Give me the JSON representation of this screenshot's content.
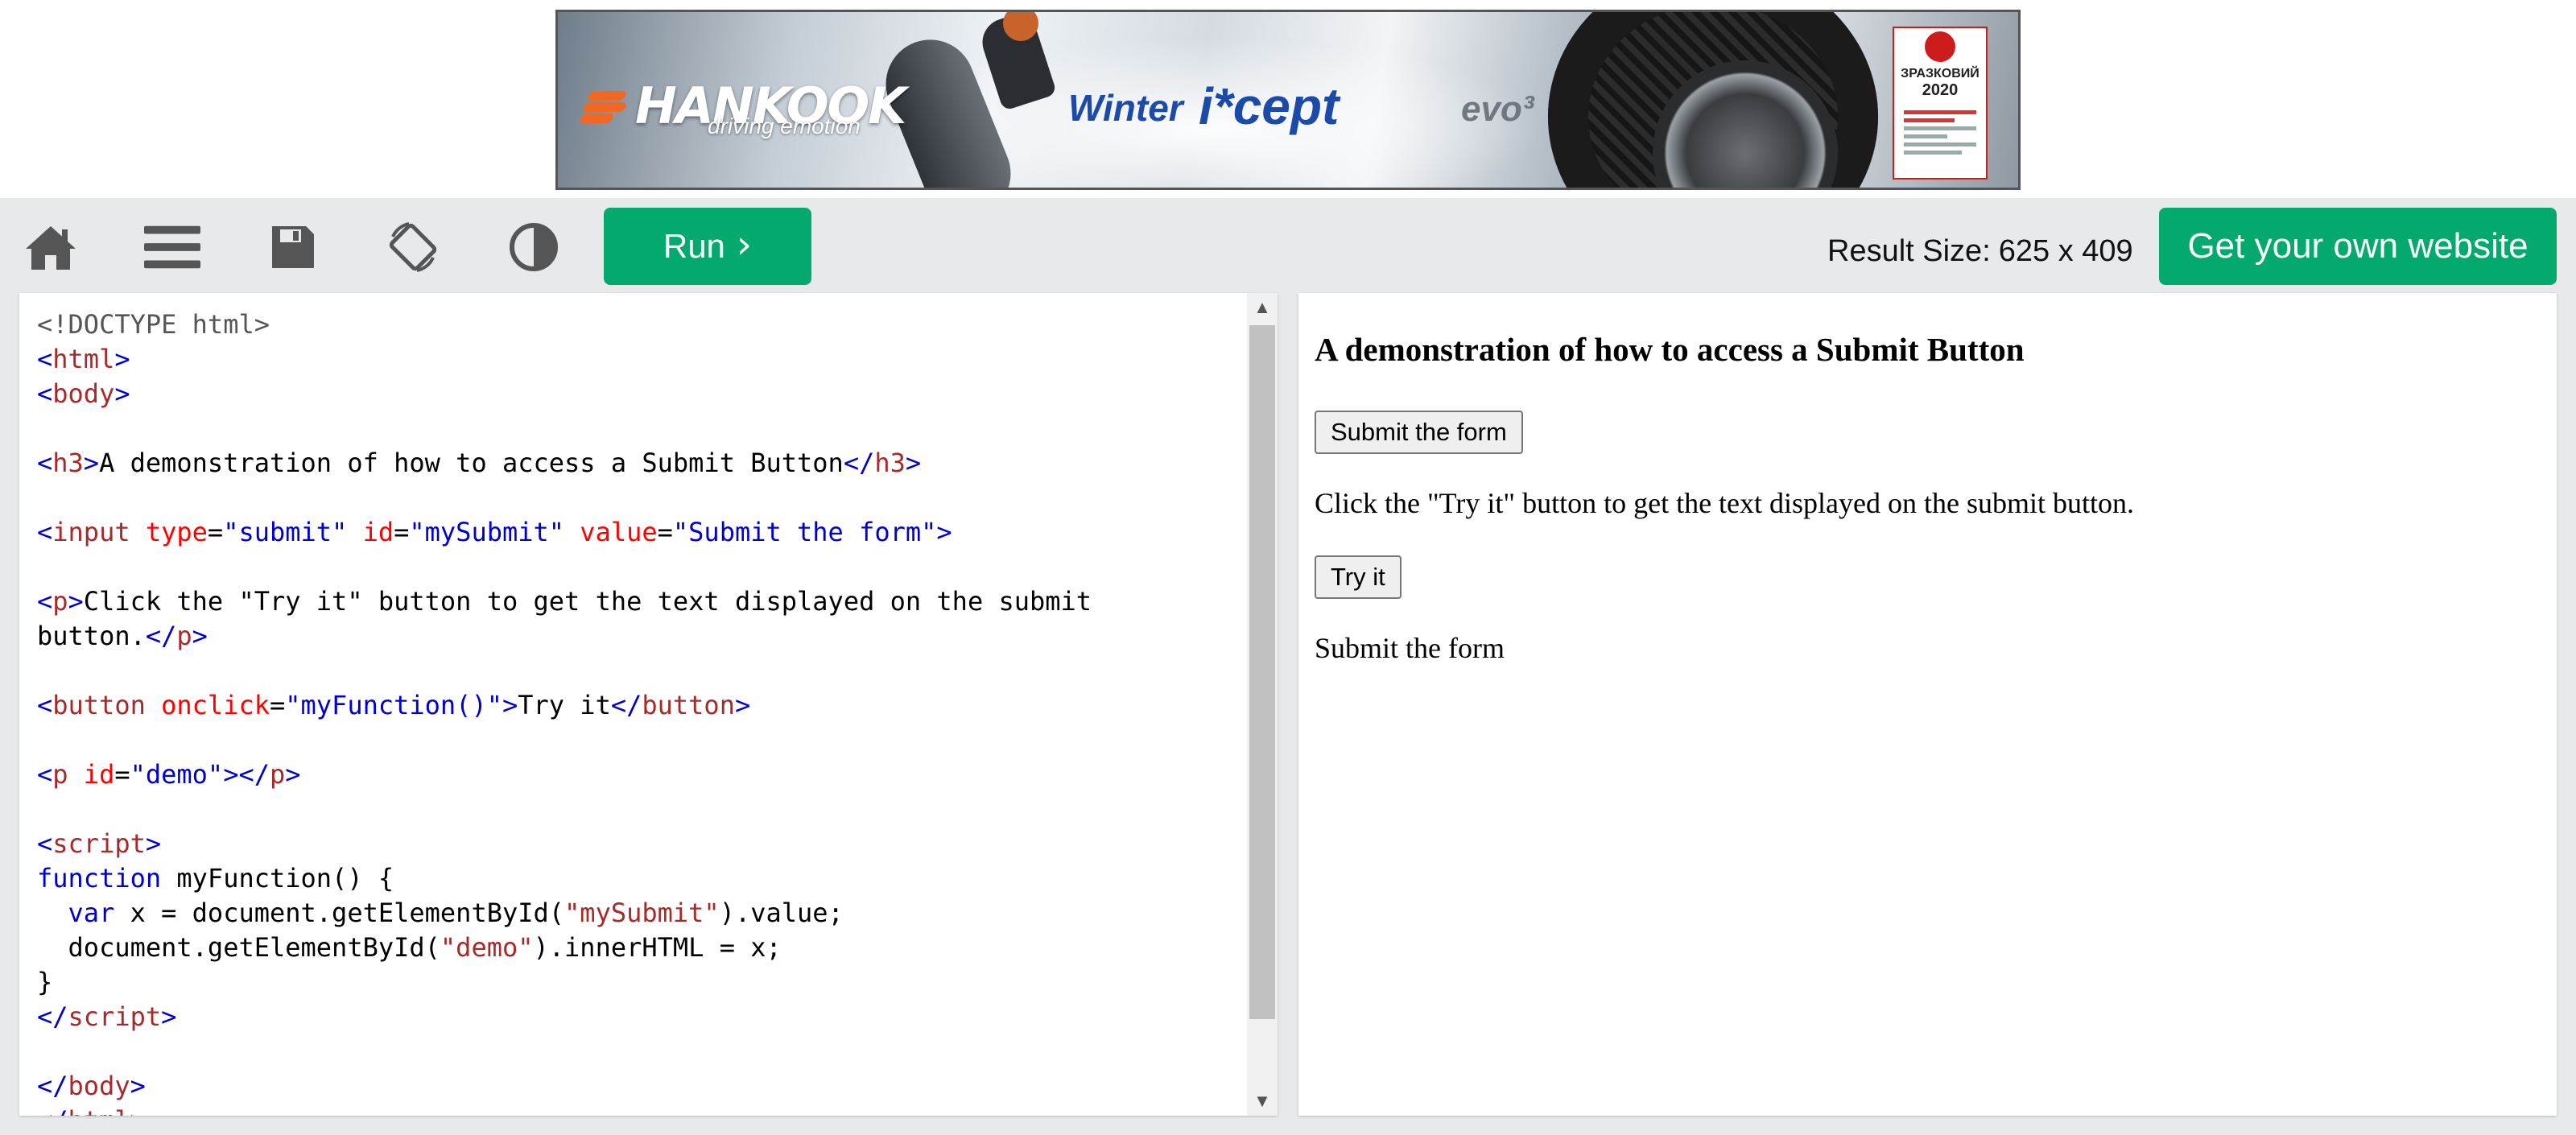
{
  "ad": {
    "brand": "HANKOOK",
    "tagline": "driving emotion",
    "product_word": "Winter",
    "product_name": "i*cept",
    "product_suffix": "evo³",
    "badge_title": "ЗРАЗКОВИЙ",
    "badge_year": "2020",
    "brand_color": "#f26722"
  },
  "toolbar": {
    "icons": [
      "home-icon",
      "menu-icon",
      "save-icon",
      "rotate-icon",
      "contrast-icon"
    ],
    "run_label": "Run",
    "run_chevron": "›",
    "result_size_label": "Result Size:",
    "result_size_value": "625 x 409",
    "own_website_label": "Get your own website",
    "accent_color": "#04aa6d"
  },
  "editor": {
    "line_count": 22
  },
  "result": {
    "heading": "A demonstration of how to access a Submit Button",
    "submit_value": "Submit the form",
    "instruction": "Click the \"Try it\" button to get the text displayed on the submit button.",
    "try_button": "Try it",
    "demo_output": "Submit the form"
  }
}
